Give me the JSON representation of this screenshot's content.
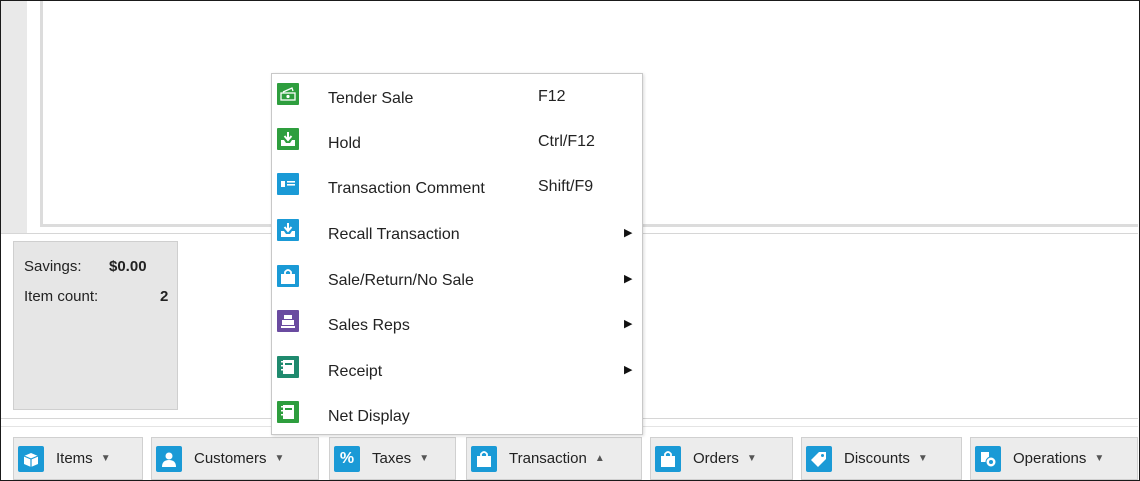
{
  "colors": {
    "green": "#2e9e3e",
    "blue": "#1a9ad6",
    "purple": "#6a4ba0",
    "toolbar_bg": "#ececec"
  },
  "summary": {
    "savings_label": "Savings:",
    "savings_value": "$0.00",
    "item_count_label": "Item count:",
    "item_count_value": "2"
  },
  "menu": {
    "items": [
      {
        "label": "Tender Sale",
        "shortcut": "F12",
        "submenu": "",
        "icon": "tender-sale-icon",
        "color": "#2e9e3e"
      },
      {
        "label": "Hold",
        "shortcut": "Ctrl/F12",
        "submenu": "",
        "icon": "hold-icon",
        "color": "#2e9e3e"
      },
      {
        "label": "Transaction Comment",
        "shortcut": "Shift/F9",
        "submenu": "",
        "icon": "comment-card-icon",
        "color": "#1a9ad6"
      },
      {
        "label": "Recall Transaction",
        "shortcut": "",
        "submenu": "▶",
        "icon": "recall-icon",
        "color": "#1a9ad6"
      },
      {
        "label": "Sale/Return/No Sale",
        "shortcut": "",
        "submenu": "▶",
        "icon": "shopping-bag-icon",
        "color": "#1a9ad6"
      },
      {
        "label": "Sales Reps",
        "shortcut": "",
        "submenu": "▶",
        "icon": "register-icon",
        "color": "#6a4ba0"
      },
      {
        "label": "Receipt",
        "shortcut": "",
        "submenu": "▶",
        "icon": "receipt-icon",
        "color": "#1f8a6e"
      },
      {
        "label": "Net Display",
        "shortcut": "",
        "submenu": "",
        "icon": "net-display-icon",
        "color": "#2e9e3e"
      }
    ]
  },
  "toolbar": {
    "buttons": [
      {
        "label": "Items",
        "arrow": "▼",
        "icon": "box-icon",
        "color": "#1a9ad6"
      },
      {
        "label": "Customers",
        "arrow": "▼",
        "icon": "person-icon",
        "color": "#1a9ad6"
      },
      {
        "label": "Taxes",
        "arrow": "▼",
        "icon": "percent-icon",
        "color": "#1a9ad6"
      },
      {
        "label": "Transaction",
        "arrow": "▲",
        "icon": "shopping-bag-icon",
        "color": "#1a9ad6"
      },
      {
        "label": "Orders",
        "arrow": "▼",
        "icon": "order-bag-icon",
        "color": "#1a9ad6"
      },
      {
        "label": "Discounts",
        "arrow": "▼",
        "icon": "tag-icon",
        "color": "#1a9ad6"
      },
      {
        "label": "Operations",
        "arrow": "▼",
        "icon": "operations-icon",
        "color": "#1a9ad6"
      }
    ]
  }
}
